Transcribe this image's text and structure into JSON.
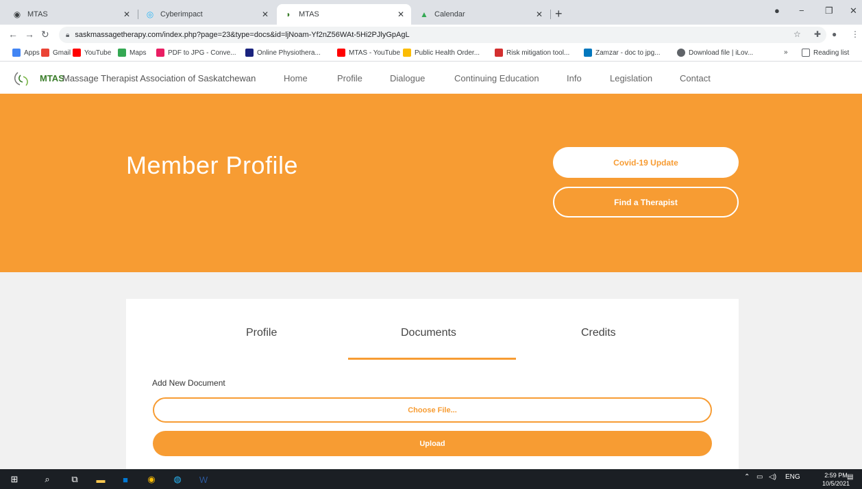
{
  "browser": {
    "tabs": [
      {
        "title": "MTAS",
        "icon": "globe-icon"
      },
      {
        "title": "Cyberimpact",
        "icon": "cyberimpact-icon"
      },
      {
        "title": "MTAS",
        "icon": "mtas-icon"
      },
      {
        "title": "Calendar",
        "icon": "calendar-icon"
      }
    ],
    "url": "saskmassagetherapy.com/index.php?page=23&type=docs&id=ljNoam-Yf2nZ56WAt-5Hi2PJlyGpAgL",
    "bookmarks": [
      {
        "label": "Apps",
        "color": "#4285f4"
      },
      {
        "label": "Gmail",
        "color": "#ea4335"
      },
      {
        "label": "YouTube",
        "color": "#ff0000"
      },
      {
        "label": "Maps",
        "color": "#34a853"
      },
      {
        "label": "PDF to JPG - Conve...",
        "color": "#e91e63"
      },
      {
        "label": "Online Physiothera...",
        "color": "#1a237e"
      },
      {
        "label": "MTAS - YouTube",
        "color": "#ff0000"
      },
      {
        "label": "Public Health Order...",
        "color": "#fbbc04"
      },
      {
        "label": "Risk mitigation tool...",
        "color": "#d32f2f"
      },
      {
        "label": "Zamzar - doc to jpg...",
        "color": "#0277bd"
      },
      {
        "label": "Download file | iLov...",
        "color": "#5f6368"
      }
    ],
    "reading_list": "Reading list",
    "more_bookmarks": "»"
  },
  "site": {
    "logo_short": "MTAS",
    "logo_full": "Massage Therapist Association of Saskatchewan",
    "nav": [
      "Home",
      "Profile",
      "Dialogue",
      "Continuing Education",
      "Info",
      "Legislation",
      "Contact"
    ]
  },
  "hero": {
    "title": "Member Profile",
    "covid_button": "Covid-19 Update",
    "find_button": "Find a Therapist"
  },
  "profile": {
    "tabs": [
      "Profile",
      "Documents",
      "Credits"
    ],
    "active_tab": "Documents",
    "add_label": "Add New Document",
    "choose_file": "Choose File...",
    "upload": "Upload"
  },
  "taskbar": {
    "lang": "ENG",
    "time": "2:59 PM",
    "date": "10/5/2021"
  },
  "colors": {
    "accent": "#f79c33",
    "brand_green": "#3a7d2a"
  }
}
